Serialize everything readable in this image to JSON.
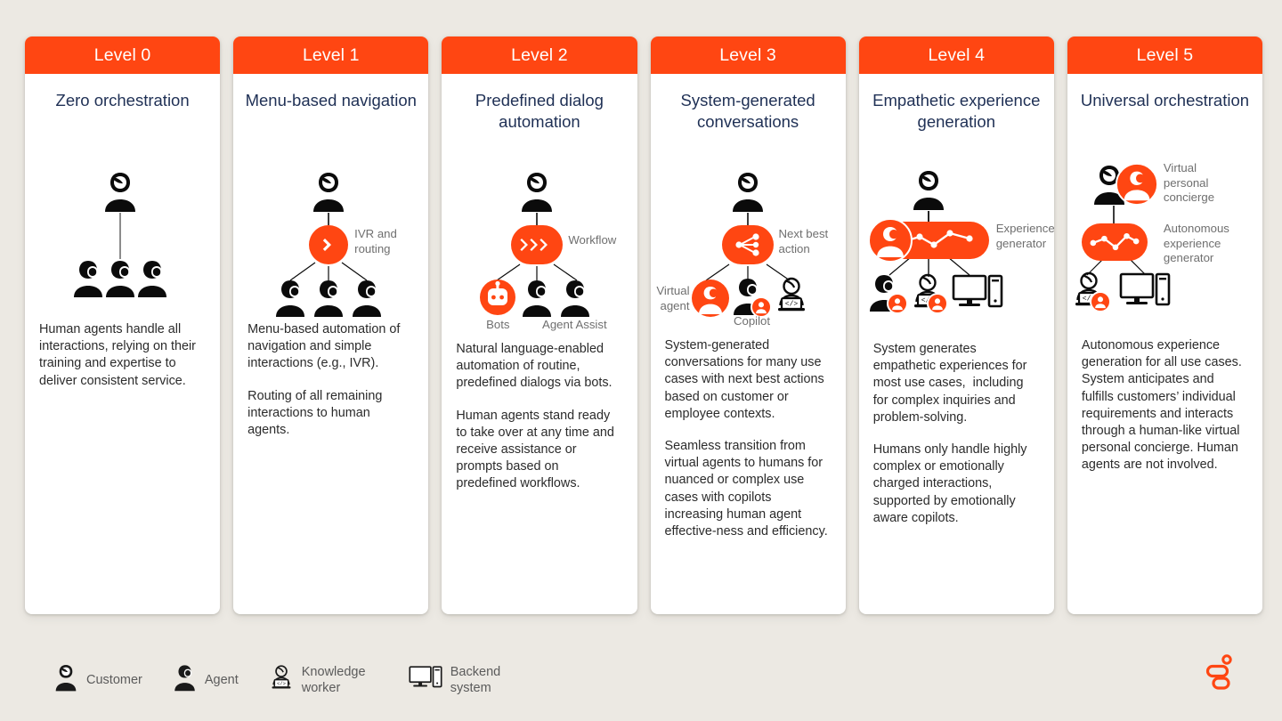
{
  "theme": {
    "accent": "#FF4612",
    "header_text": "#FFFFFF",
    "title_color": "#1F3055",
    "body_color": "#2B2B2B",
    "label_color": "#6F6F6F",
    "page_background": "#ECE9E3",
    "card_background": "#FFFFFF"
  },
  "cards": [
    {
      "level": "Level 0",
      "title": "Zero orchestration",
      "diagram": {
        "name": "zero-orchestration-diagram",
        "hub": null,
        "hub_label": "",
        "node_labels": []
      },
      "paragraphs": [
        "Human agents handle all interactions, relying on their training and expertise to deliver consistent service."
      ]
    },
    {
      "level": "Level 1",
      "title": "Menu-based navigation",
      "diagram": {
        "name": "menu-based-navigation-diagram",
        "hub": "chevron-single-icon",
        "hub_label": "IVR and routing",
        "node_labels": []
      },
      "paragraphs": [
        "Menu-based automation of navigation and simple interactions (e.g., IVR).",
        "Routing of all remaining interactions to human agents."
      ]
    },
    {
      "level": "Level 2",
      "title": "Predefined dialog automation",
      "diagram": {
        "name": "predefined-dialog-automation-diagram",
        "hub": "chevron-triple-icon",
        "hub_label": "Workflow",
        "node_labels": [
          "Bots",
          "Agent Assist"
        ]
      },
      "paragraphs": [
        "Natural language-enabled automation of routine, predefined dialogs via bots.",
        "Human agents stand ready to take over at any time and receive assistance or prompts based on predefined workflows."
      ]
    },
    {
      "level": "Level 3",
      "title": "System-generated conversations",
      "diagram": {
        "name": "system-generated-conversations-diagram",
        "hub": "share-nodes-icon",
        "hub_label": "Next best action",
        "node_labels": [
          "Virtual agent",
          "Copilot"
        ]
      },
      "paragraphs": [
        "System-generated conversations for many use cases with next best actions based on customer or employee contexts.",
        "Seamless transition from virtual agents to humans for nuanced or complex use cases with copilots increasing human agent effective-ness and efficiency."
      ]
    },
    {
      "level": "Level 4",
      "title": "Empathetic experience generation",
      "diagram": {
        "name": "empathetic-experience-generation-diagram",
        "hub": "line-chart-icon",
        "hub_label": "Experience generator",
        "node_labels": []
      },
      "paragraphs": [
        "System generates empathetic experiences for most use cases,  including for complex inquiries and problem-solving.",
        "Humans only handle highly complex or emotionally charged interactions, supported by emotionally aware copilots."
      ]
    },
    {
      "level": "Level 5",
      "title": "Universal orchestration",
      "diagram": {
        "name": "universal-orchestration-diagram",
        "hub": "line-chart-icon",
        "hub_label": "Autonomous experience generator",
        "node_labels": [
          "Virtual personal concierge"
        ]
      },
      "paragraphs": [
        "Autonomous experience generation for all use cases. System anticipates and fulfills customers’ individual requirements and interacts through a human-like virtual personal concierge. Human agents are not involved."
      ]
    }
  ],
  "legend": [
    {
      "icon": "customer-icon",
      "label": "Customer"
    },
    {
      "icon": "agent-icon",
      "label": "Agent"
    },
    {
      "icon": "knowledge-worker-icon",
      "label": "Knowledge worker"
    },
    {
      "icon": "backend-system-icon",
      "label": "Backend system"
    }
  ],
  "logo": {
    "name": "genesys-logo",
    "color": "#FF4612"
  }
}
